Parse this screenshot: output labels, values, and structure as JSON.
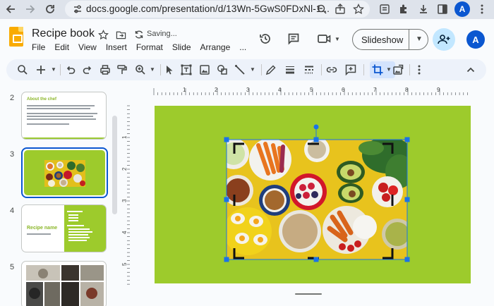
{
  "browser": {
    "url": "docs.google.com/presentation/d/13Wn-5GwS0FDxNl-1...",
    "profile_initial": "A"
  },
  "doc": {
    "title": "Recipe book",
    "status": "Saving..."
  },
  "menu": [
    "File",
    "Edit",
    "View",
    "Insert",
    "Format",
    "Slide",
    "Arrange",
    "..."
  ],
  "header": {
    "slideshow_label": "Slideshow",
    "user_initial": "A"
  },
  "colors": {
    "slide_bg": "#9dcb2c",
    "selection_blue": "#1a73e8",
    "accent_green": "#8cb72b"
  },
  "filmstrip": {
    "slides": [
      {
        "number": "2",
        "title": "About the chef"
      },
      {
        "number": "3",
        "title": ""
      },
      {
        "number": "4",
        "title": "Recipe name"
      },
      {
        "number": "5",
        "title": ""
      }
    ],
    "selected": "3"
  },
  "ruler": {
    "h_labels": [
      "1",
      "2",
      "3",
      "4",
      "5",
      "6",
      "7",
      "8",
      "9"
    ],
    "v_labels": [
      "1",
      "2",
      "3",
      "4",
      "5"
    ]
  },
  "toolbar": {
    "icons": [
      "search-icon",
      "new-slide-icon",
      "undo-icon",
      "redo-icon",
      "print-icon",
      "paint-format-icon",
      "zoom-icon",
      "select-icon",
      "text-box-icon",
      "image-icon",
      "shape-icon",
      "line-icon",
      "pen-icon",
      "border-weight-icon",
      "border-dash-icon",
      "link-icon",
      "comment-icon",
      "crop-icon",
      "replace-image-icon",
      "more-icon",
      "collapse-icon"
    ]
  }
}
